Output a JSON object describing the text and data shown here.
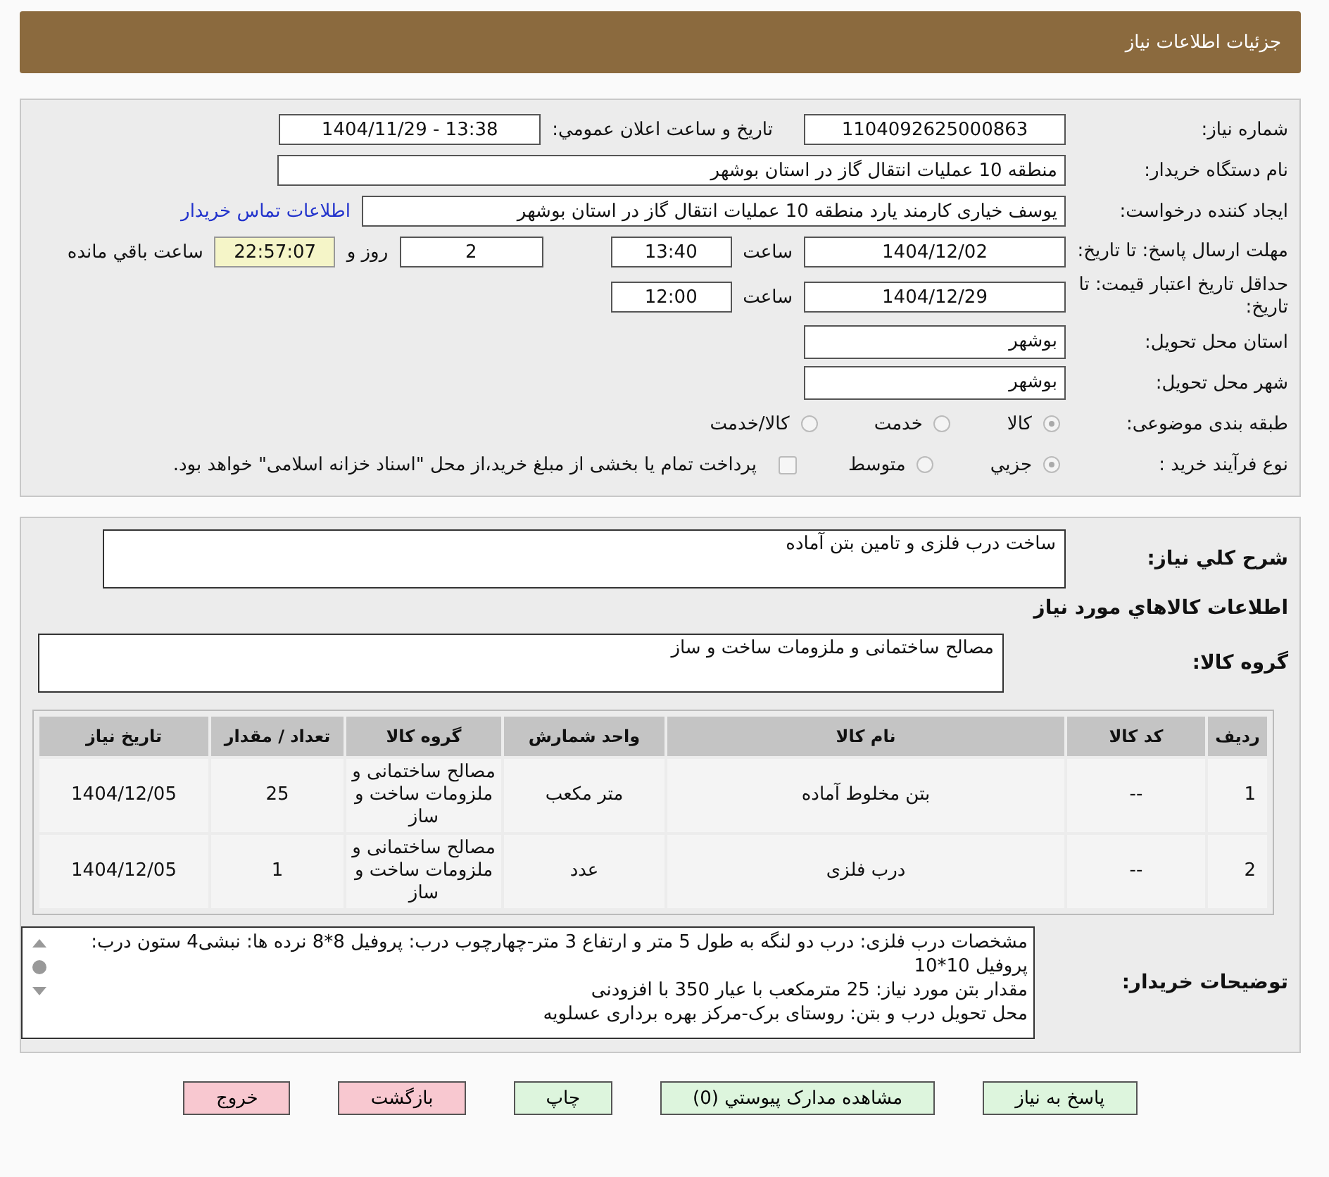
{
  "header": {
    "title": "جزئیات اطلاعات نیاز"
  },
  "need_number": {
    "label": "شماره نیاز:",
    "value": "1104092625000863"
  },
  "announce": {
    "label": "تاریخ و ساعت اعلان عمومي:",
    "value": "1404/11/29 - 13:38"
  },
  "buyer_org": {
    "label": "نام دستگاه خریدار:",
    "value": "منطقه 10 عملیات انتقال گاز در استان بوشهر"
  },
  "requester": {
    "label": "ایجاد کننده درخواست:",
    "value": "یوسف خیاری کارمند یارد منطقه 10 عملیات انتقال گاز در استان بوشهر",
    "link": "اطلاعات تماس خریدار"
  },
  "deadline": {
    "label": "مهلت ارسال پاسخ: تا تاریخ:",
    "date": "1404/12/02",
    "time_label": "ساعت",
    "time": "13:40",
    "days": "2",
    "days_label": "روز و",
    "remaining": "22:57:07",
    "remaining_label": "ساعت باقي مانده"
  },
  "validity": {
    "label": "حداقل تاریخ اعتبار قیمت: تا تاریخ:",
    "date": "1404/12/29",
    "time_label": "ساعت",
    "time": "12:00"
  },
  "province": {
    "label": "استان محل تحویل:",
    "value": "بوشهر"
  },
  "city": {
    "label": "شهر محل تحویل:",
    "value": "بوشهر"
  },
  "category": {
    "label": "طبقه بندی موضوعی:",
    "options": [
      {
        "label": "کالا",
        "selected": true
      },
      {
        "label": "خدمت",
        "selected": false
      },
      {
        "label": "کالا/خدمت",
        "selected": false
      }
    ]
  },
  "process": {
    "label": "نوع فرآیند خرید :",
    "options": [
      {
        "label": "جزيي",
        "selected": true
      },
      {
        "label": "متوسط",
        "selected": false
      }
    ],
    "payment": {
      "label": "پرداخت تمام یا بخشی از مبلغ خرید،از محل \"اسناد خزانه اسلامی\" خواهد بود.",
      "checked": false
    }
  },
  "summary": {
    "label": "شرح كلي نیاز:",
    "value": "ساخت درب فلزی و تامین بتن آماده"
  },
  "goods_heading": "اطلاعات كالاهاي مورد نياز",
  "goods_group": {
    "label": "گروه کالا:",
    "value": "مصالح ساختمانی و ملزومات ساخت و ساز"
  },
  "table": {
    "columns": [
      "ردیف",
      "کد کالا",
      "نام کالا",
      "واحد شمارش",
      "گروه کالا",
      "تعداد / مقدار",
      "تاریخ نیاز"
    ],
    "rows": [
      [
        "1",
        "--",
        "بتن مخلوط آماده",
        "متر مکعب",
        "مصالح ساختمانی و ملزومات ساخت و ساز",
        "25",
        "1404/12/05"
      ],
      [
        "2",
        "--",
        "درب فلزی",
        "عدد",
        "مصالح ساختمانی و ملزومات ساخت و ساز",
        "1",
        "1404/12/05"
      ]
    ]
  },
  "buyer_notes": {
    "label": "توضیحات خریدار:",
    "lines": [
      "مشخصات درب فلزی: درب دو لنگه به طول 5 متر و ارتفاع 3 متر-چهارچوب درب: پروفیل 8*8 نرده ها: نبشی4  ستون درب: پروفیل 10*10",
      "مقدار بتن مورد نیاز: 25 مترمکعب با عیار 350 با افزودنی",
      "محل تحویل درب و بتن: روستای برک-مرکز بهره برداری عسلویه"
    ]
  },
  "buttons": [
    {
      "label": "پاسخ به نیاز",
      "kind": "action"
    },
    {
      "label": "مشاهده مدارک پیوستي (0)",
      "kind": "action"
    },
    {
      "label": "چاپ",
      "kind": "action"
    },
    {
      "label": "بازگشت",
      "kind": "exit"
    },
    {
      "label": "خروج",
      "kind": "exit"
    }
  ]
}
